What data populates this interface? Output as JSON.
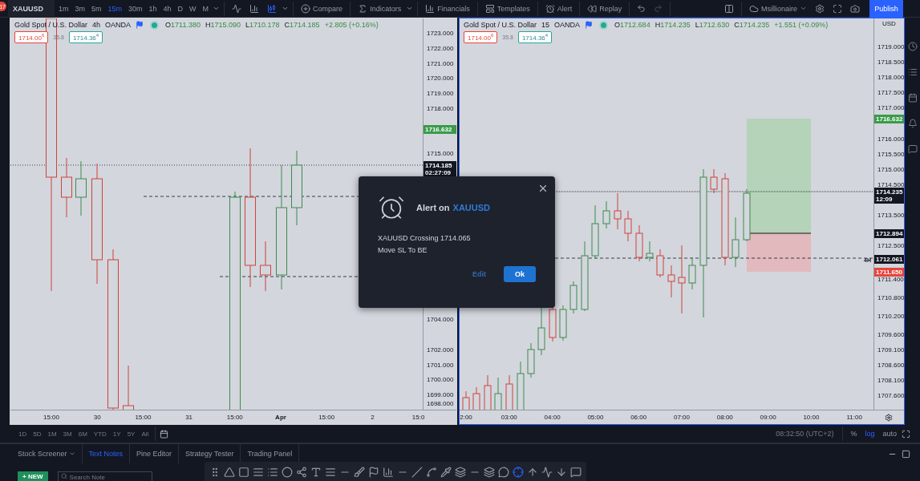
{
  "toolbar": {
    "badge": "17",
    "symbol": "XAUUSD",
    "intervals": [
      {
        "label": "1m",
        "selected": false
      },
      {
        "label": "3m",
        "selected": false
      },
      {
        "label": "5m",
        "selected": false
      },
      {
        "label": "15m",
        "selected": true
      },
      {
        "label": "30m",
        "selected": false
      },
      {
        "label": "1h",
        "selected": false
      },
      {
        "label": "4h",
        "selected": false
      },
      {
        "label": "D",
        "selected": false
      },
      {
        "label": "W",
        "selected": false
      },
      {
        "label": "M",
        "selected": false
      }
    ],
    "buttons": [
      {
        "kind": "compare",
        "label": "Compare"
      },
      {
        "kind": "indicators",
        "label": "Indicators"
      },
      {
        "kind": "financials",
        "label": "Financials"
      },
      {
        "kind": "templates",
        "label": "Templates"
      },
      {
        "kind": "alert",
        "label": "Alert"
      },
      {
        "kind": "replay",
        "label": "Replay"
      }
    ],
    "layout_name": "Msillionaire",
    "publish": "Publish"
  },
  "panes": [
    {
      "active": false,
      "title": "Gold Spot / U.S. Dollar",
      "interval": "4h",
      "exchange": "OANDA",
      "ohlc": [
        {
          "label": "O",
          "value": "1711.380"
        },
        {
          "label": "H",
          "value": "1715.090"
        },
        {
          "label": "L",
          "value": "1710.178"
        },
        {
          "label": "C",
          "value": "1714.185"
        }
      ],
      "change": "+2.805 (+0.16%)",
      "sell": "1714.00$^{6}$",
      "spread": "35.8",
      "buy": "1714.36$^{4}$",
      "price_ticks": [
        "1723.000",
        "1722.000",
        "1721.000",
        "1720.000",
        "1719.000",
        "1718.000",
        "1715.000",
        "1704.000",
        "1702.000",
        "1701.000",
        "1700.000",
        "1699.000",
        "1698.000"
      ],
      "price_tags": [
        {
          "price": "1716.632",
          "color": "#3a9b4a"
        },
        {
          "price": "1714.185",
          "time": "02:27:09",
          "color": "#131722"
        }
      ],
      "time_ticks": [
        {
          "label": "15:00",
          "bold": false
        },
        {
          "label": "30",
          "bold": false
        },
        {
          "label": "15:00",
          "bold": false
        },
        {
          "label": "31",
          "bold": false
        },
        {
          "label": "15:00",
          "bold": false
        },
        {
          "label": "Apr",
          "bold": true
        },
        {
          "label": "15:00",
          "bold": false
        },
        {
          "label": "2",
          "bold": false
        },
        {
          "label": "15:0",
          "bold": false
        }
      ]
    },
    {
      "active": true,
      "title": "Gold Spot / U.S. Dollar",
      "interval": "15",
      "exchange": "OANDA",
      "ohlc": [
        {
          "label": "O",
          "value": "1712.684"
        },
        {
          "label": "H",
          "value": "1714.235"
        },
        {
          "label": "L",
          "value": "1712.630"
        },
        {
          "label": "C",
          "value": "1714.235"
        }
      ],
      "change": "+1.551 (+0.09%)",
      "sell": "1714.00$^{6}$",
      "spread": "35.8",
      "buy": "1714.36$^{4}$",
      "currency": "USD",
      "level_label": "4H",
      "price_ticks": [
        "1719.000",
        "1718.500",
        "1718.000",
        "1717.500",
        "1717.000",
        "1716.000",
        "1715.500",
        "1715.000",
        "1714.500",
        "1713.500",
        "1712.500",
        "1711.400",
        "1710.800",
        "1710.200",
        "1709.600",
        "1709.100",
        "1708.600",
        "1708.100",
        "1707.600"
      ],
      "price_tags": [
        {
          "price": "1716.632",
          "color": "#3a9b4a"
        },
        {
          "price": "1714.235",
          "time": "12:09",
          "color": "#131722"
        },
        {
          "price": "1712.894",
          "color": "#131722"
        },
        {
          "price": "1712.061",
          "color": "#131722"
        },
        {
          "price": "1711.650",
          "color": "#e8453c"
        }
      ],
      "time_ticks": [
        {
          "label": "2:00",
          "bold": false
        },
        {
          "label": "03:00",
          "bold": false
        },
        {
          "label": "04:00",
          "bold": false
        },
        {
          "label": "05:00",
          "bold": false
        },
        {
          "label": "06:00",
          "bold": false
        },
        {
          "label": "07:00",
          "bold": false
        },
        {
          "label": "08:00",
          "bold": false
        },
        {
          "label": "09:00",
          "bold": false
        },
        {
          "label": "10:00",
          "bold": false
        },
        {
          "label": "11:00",
          "bold": false
        }
      ]
    }
  ],
  "range_bar": {
    "ranges": [
      "1D",
      "5D",
      "1M",
      "3M",
      "6M",
      "YTD",
      "1Y",
      "5Y",
      "All"
    ],
    "clock": "08:32:50 (UTC+2)",
    "scale_options": [
      {
        "label": "%",
        "selected": false
      },
      {
        "label": "log",
        "selected": true
      },
      {
        "label": "auto",
        "selected": false
      }
    ]
  },
  "bottom_tabs": [
    {
      "label": "Stock Screener",
      "selected": false,
      "has_menu": true
    },
    {
      "label": "Text Notes",
      "selected": true,
      "has_menu": false
    },
    {
      "label": "Pine Editor",
      "selected": false,
      "has_menu": false
    },
    {
      "label": "Strategy Tester",
      "selected": false,
      "has_menu": false
    },
    {
      "label": "Trading Panel",
      "selected": false,
      "has_menu": false
    }
  ],
  "notes": {
    "new_button": "+ NEW",
    "search": {
      "placeholder": "Search Note"
    }
  },
  "alert": {
    "title": "Alert on",
    "symbol": "XAUUSD",
    "lines": [
      "XAUUSD Crossing 1714.065",
      "Move SL To BE"
    ],
    "buttons": [
      {
        "kind": "link",
        "label": "Edit"
      },
      {
        "kind": "primary",
        "label": "Ok"
      }
    ]
  }
}
